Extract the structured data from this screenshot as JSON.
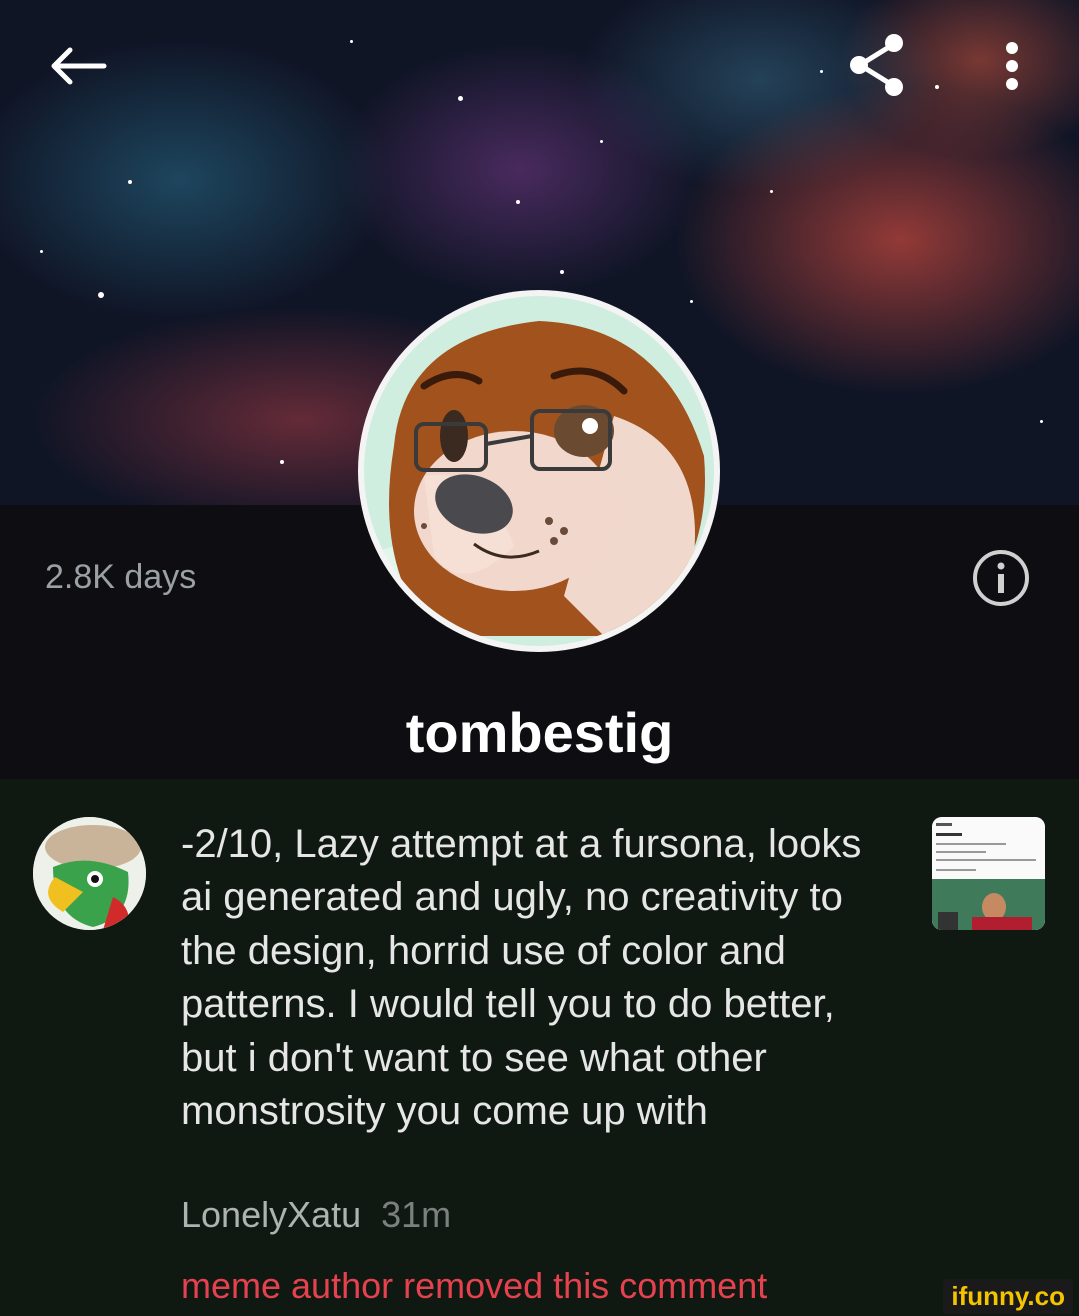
{
  "header": {
    "back_icon": "arrow-left-icon",
    "share_icon": "share-icon",
    "more_icon": "more-vertical-icon"
  },
  "profile": {
    "days": "2.8K days",
    "username": "tombestig",
    "info_icon": "info-icon"
  },
  "comment": {
    "text": "-2/10, Lazy attempt at a fursona, looks ai generated and ugly, no creativity to the design, horrid use of color and patterns. I would tell you to do better, but i don't want to see what other monstrosity you come up with",
    "author": "LonelyXatu",
    "time": "31m",
    "status": "meme author removed this comment"
  },
  "watermark": "ifunny.co",
  "colors": {
    "removed": "#e5414f",
    "watermark": "#f5c400"
  }
}
